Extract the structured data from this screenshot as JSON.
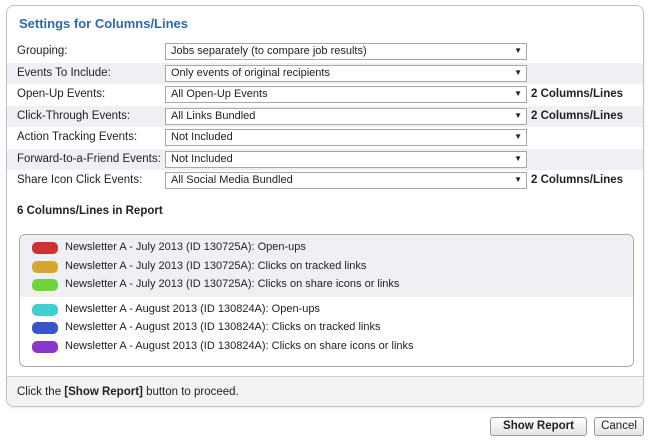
{
  "panel": {
    "title": "Settings for Columns/Lines"
  },
  "settings": [
    {
      "label": "Grouping:",
      "value": "Jobs separately (to compare job results)",
      "note": ""
    },
    {
      "label": "Events To Include:",
      "value": "Only events of original recipients",
      "note": ""
    },
    {
      "label": "Open-Up Events:",
      "value": "All Open-Up Events",
      "note": "2 Columns/Lines"
    },
    {
      "label": "Click-Through Events:",
      "value": "All Links Bundled",
      "note": "2 Columns/Lines"
    },
    {
      "label": "Action Tracking Events:",
      "value": "Not Included",
      "note": ""
    },
    {
      "label": "Forward-to-a-Friend Events:",
      "value": "Not Included",
      "note": ""
    },
    {
      "label": "Share Icon Click Events:",
      "value": "All Social Media Bundled",
      "note": "2 Columns/Lines"
    }
  ],
  "summary": {
    "count_title": "6 Columns/Lines in Report"
  },
  "legend": [
    {
      "label": "Newsletter A - July 2013 (ID 130725A): Open-ups",
      "color": "#cc3333"
    },
    {
      "label": "Newsletter A - July 2013 (ID 130725A): Clicks on tracked links",
      "color": "#d4a732"
    },
    {
      "label": "Newsletter A - July 2013 (ID 130725A): Clicks on share icons or links",
      "color": "#6fd33a"
    },
    {
      "label": "Newsletter A - August 2013 (ID 130824A): Open-ups",
      "color": "#3fd0cf"
    },
    {
      "label": "Newsletter A - August 2013 (ID 130824A): Clicks on tracked links",
      "color": "#3a55c8"
    },
    {
      "label": "Newsletter A - August 2013 (ID 130824A): Clicks on share icons or links",
      "color": "#8c37c9"
    }
  ],
  "footer": {
    "prefix": "Click the ",
    "bold": "[Show Report]",
    "suffix": " button to proceed."
  },
  "buttons": {
    "show_report": "Show Report",
    "cancel": "Cancel"
  },
  "icons": {
    "dropdown": "chevron-down-icon"
  }
}
